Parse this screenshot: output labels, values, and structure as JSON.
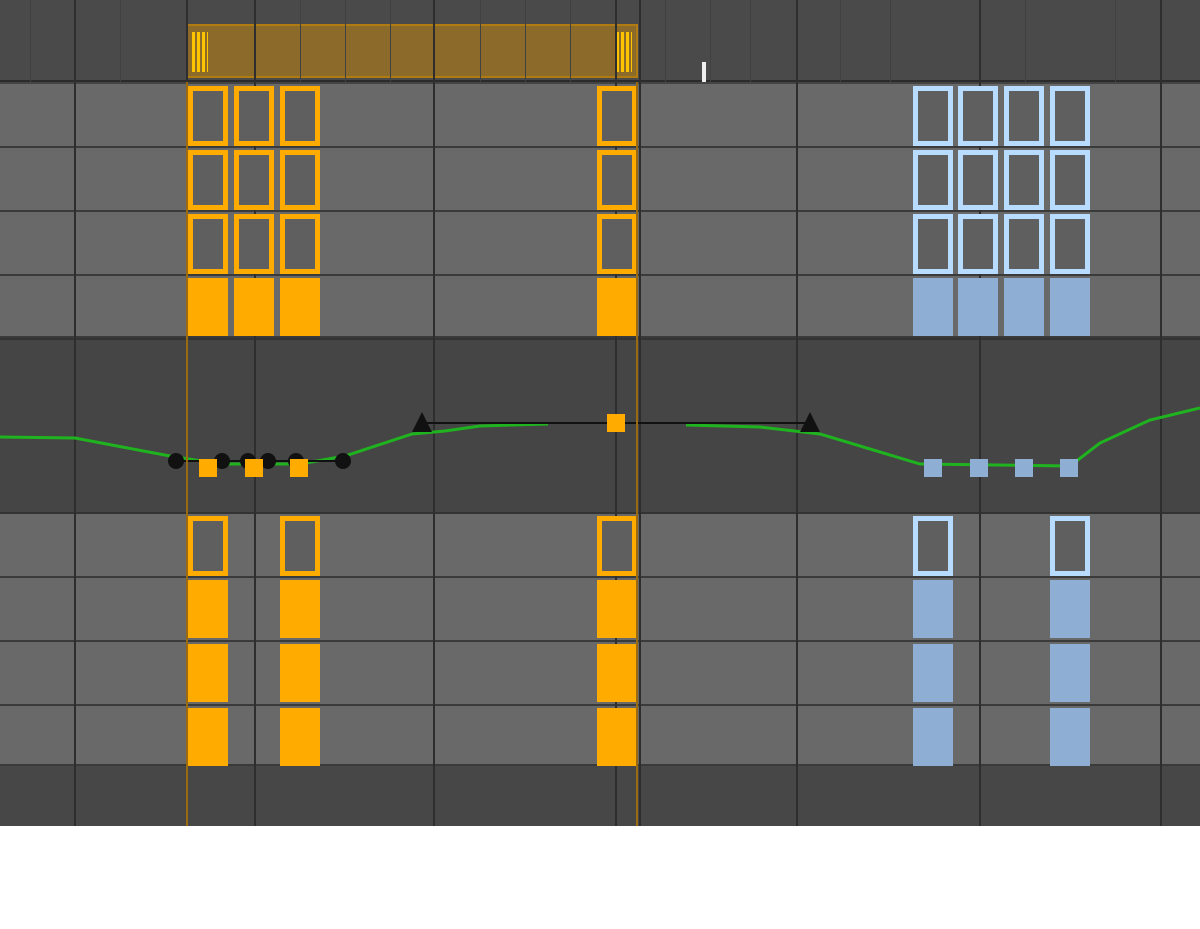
{
  "colors": {
    "selected_key": "#ffab00",
    "unselected_key_outline": "#b8dcff",
    "unselected_key_fill": "#8eaed3",
    "curve": "#1fb31f",
    "tangent": "#111111",
    "track_bg": "#696969",
    "curve_bg": "#454545"
  },
  "icons": {
    "playhead": "playhead-icon",
    "range_handle": "range-handle-icon"
  }
}
